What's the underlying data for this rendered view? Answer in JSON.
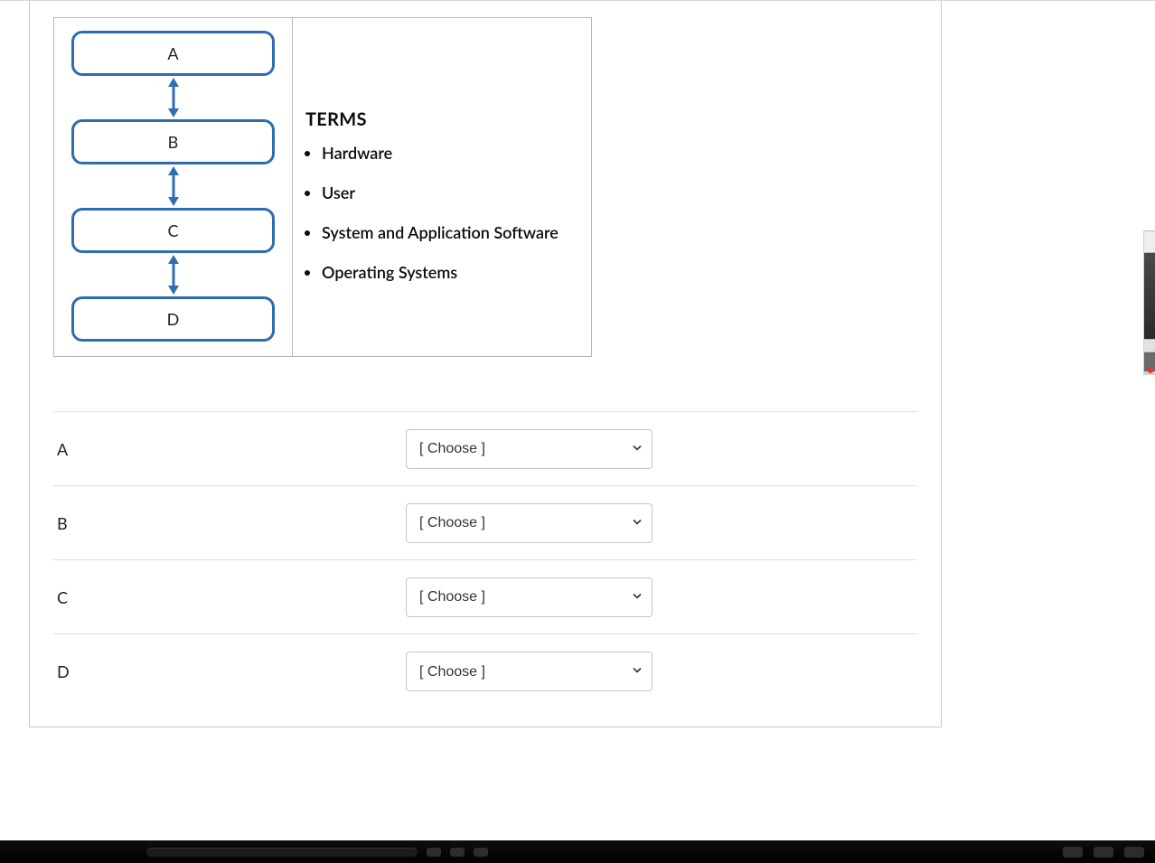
{
  "colors": {
    "box_stroke": "#2e6cb0",
    "arrow": "#2f6db1",
    "row_border": "#dedede",
    "panel_border": "#c8c8c8"
  },
  "diagram": {
    "boxes": [
      "A",
      "B",
      "C",
      "D"
    ]
  },
  "terms": {
    "heading": "TERMS",
    "items": [
      "Hardware",
      "User",
      "System and Application Software",
      "Operating Systems"
    ]
  },
  "match": {
    "placeholder": "[ Choose ]",
    "rows": [
      {
        "label": "A"
      },
      {
        "label": "B"
      },
      {
        "label": "C"
      },
      {
        "label": "D"
      }
    ]
  }
}
